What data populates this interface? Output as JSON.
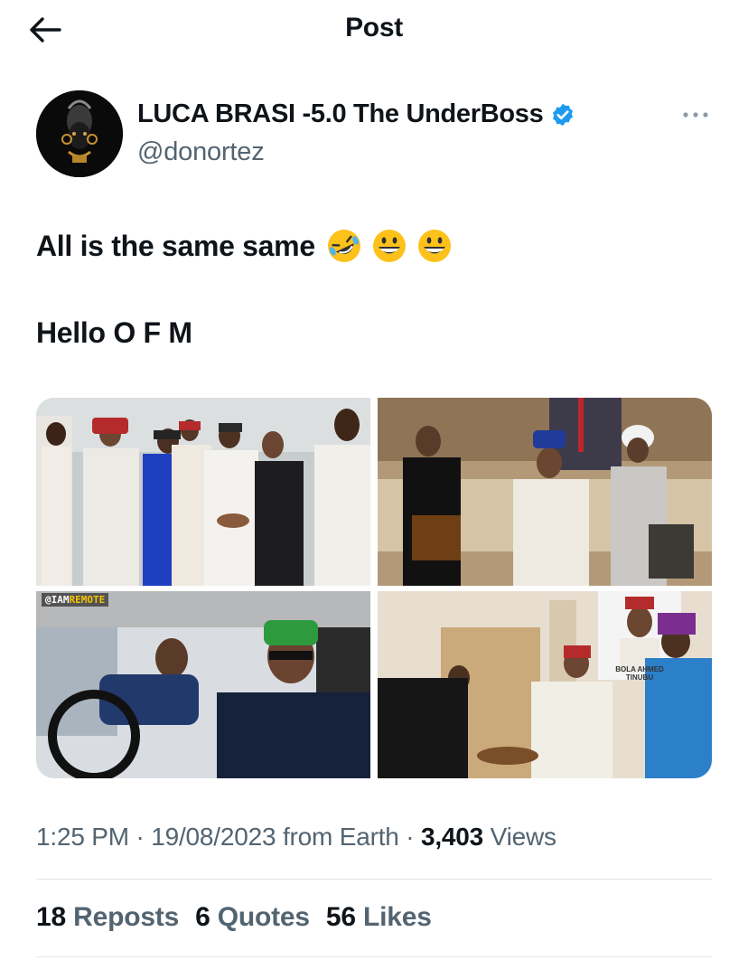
{
  "header": {
    "title": "Post",
    "back_icon": "arrow-left-icon"
  },
  "author": {
    "display_name": "LUCA BRASI -5.0 The UnderBoss",
    "handle": "@donortez",
    "verified": true,
    "verified_color": "#1d9bf0",
    "more_icon": "more-horizontal-icon"
  },
  "tweet": {
    "line1": "All is the same same",
    "emojis": [
      "rolling-on-floor-laughing",
      "grinning-face",
      "grinning-face"
    ],
    "line2": "Hello O F M"
  },
  "media": {
    "count": 4,
    "watermark_prefix": "@IAM",
    "watermark_highlight": "REMOTE",
    "poster_caption": "BOLA AHMED TINUBU"
  },
  "meta": {
    "time": "1:25 PM",
    "date": "19/08/2023",
    "source": "from Earth",
    "views_count": "3,403",
    "views_label": "Views"
  },
  "stats": {
    "reposts_count": "18",
    "reposts_label": "Reposts",
    "quotes_count": "6",
    "quotes_label": "Quotes",
    "likes_count": "56",
    "likes_label": "Likes"
  },
  "colors": {
    "text_primary": "#0f1419",
    "text_secondary": "#536471",
    "divider": "#e1e6ea",
    "verified": "#1d9bf0"
  }
}
